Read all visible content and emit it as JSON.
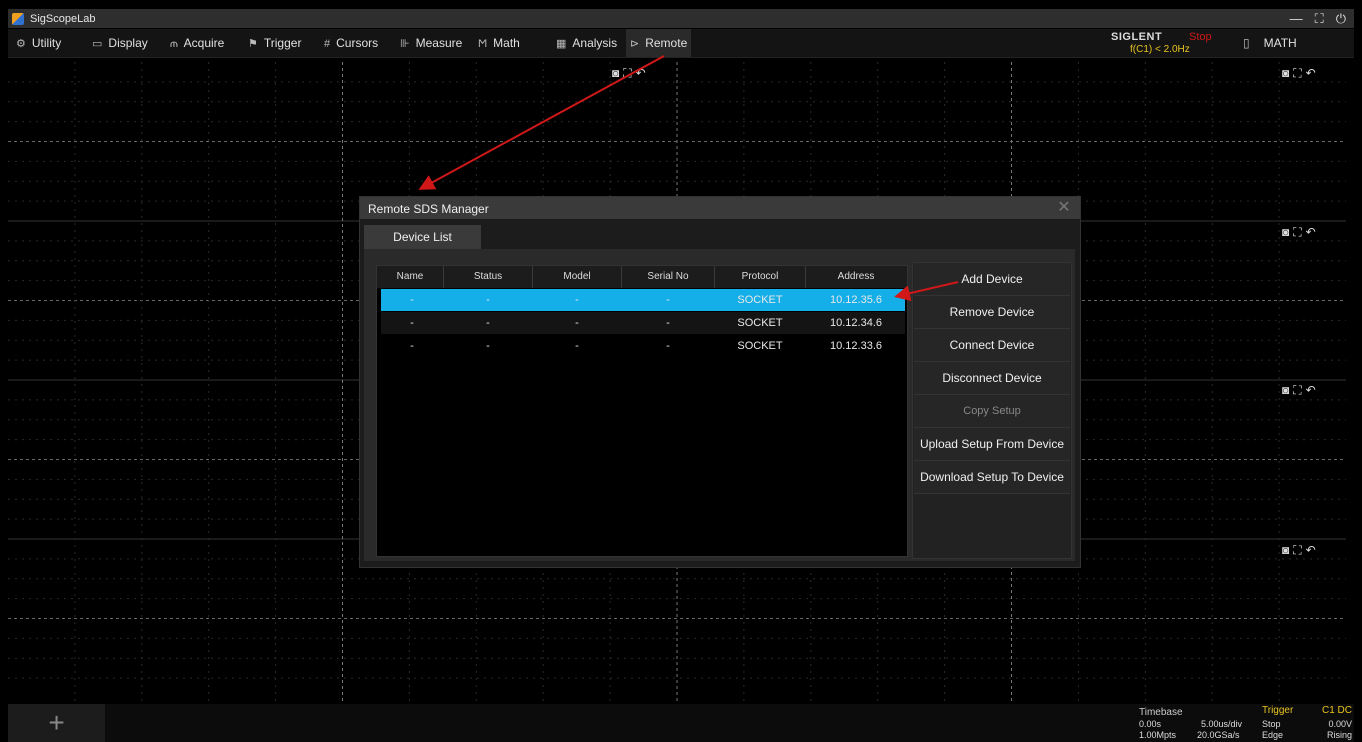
{
  "app": {
    "title": "SigScopeLab",
    "window_controls": [
      "—",
      "⛶",
      "⏻"
    ]
  },
  "menu": [
    {
      "label": "Utility",
      "icon": "⚙"
    },
    {
      "label": "Display",
      "icon": "▭"
    },
    {
      "label": "Acquire",
      "icon": "⫙"
    },
    {
      "label": "Trigger",
      "icon": "⚑"
    },
    {
      "label": "Cursors",
      "icon": "#"
    },
    {
      "label": "Measure",
      "icon": "⊪"
    },
    {
      "label": "Math",
      "icon": "Ϻ"
    },
    {
      "label": "Analysis",
      "icon": "▦"
    },
    {
      "label": "Remote",
      "icon": "⊳"
    }
  ],
  "status": {
    "brand": "SIGLENT",
    "state": "Stop",
    "trigger_freq": "f(C1) < 2.0Hz"
  },
  "math_menu": {
    "icon": "▯",
    "label": "MATH"
  },
  "panel_tools": {
    "camera": "◙",
    "expand": "⛶",
    "undo": "↶"
  },
  "dialog": {
    "title": "Remote SDS Manager",
    "close": "✕",
    "tab": "Device List",
    "columns": [
      "Name",
      "Status",
      "Model",
      "Serial No",
      "Protocol",
      "Address"
    ],
    "rows": [
      [
        "-",
        "-",
        "-",
        "-",
        "SOCKET",
        "10.12.35.6"
      ],
      [
        "-",
        "-",
        "-",
        "-",
        "SOCKET",
        "10.12.34.6"
      ],
      [
        "-",
        "-",
        "-",
        "-",
        "SOCKET",
        "10.12.33.6"
      ]
    ],
    "buttons": {
      "add": "Add Device",
      "remove": "Remove Device",
      "connect": "Connect Device",
      "disconnect": "Disconnect Device",
      "copy": "Copy Setup",
      "upload": "Upload Setup From Device",
      "download": "Download Setup To Device"
    }
  },
  "bottom": {
    "add_channel": "+",
    "timebase_label": "Timebase",
    "delay": "0.00s",
    "scale": "5.00us/div",
    "memory": "1.00Mpts",
    "sample_rate": "20.0GSa/s",
    "trigger_label": "Trigger",
    "trigger_channel": "C1 DC",
    "trigger_state": "Stop",
    "trigger_level": "0.00V",
    "trigger_type": "Edge",
    "trigger_slope": "Rising"
  },
  "colors": {
    "selection": "#14aee8",
    "accent_yellow": "#e8c420",
    "stop_red": "#d01818",
    "annotation_arrow": "#d01818"
  }
}
